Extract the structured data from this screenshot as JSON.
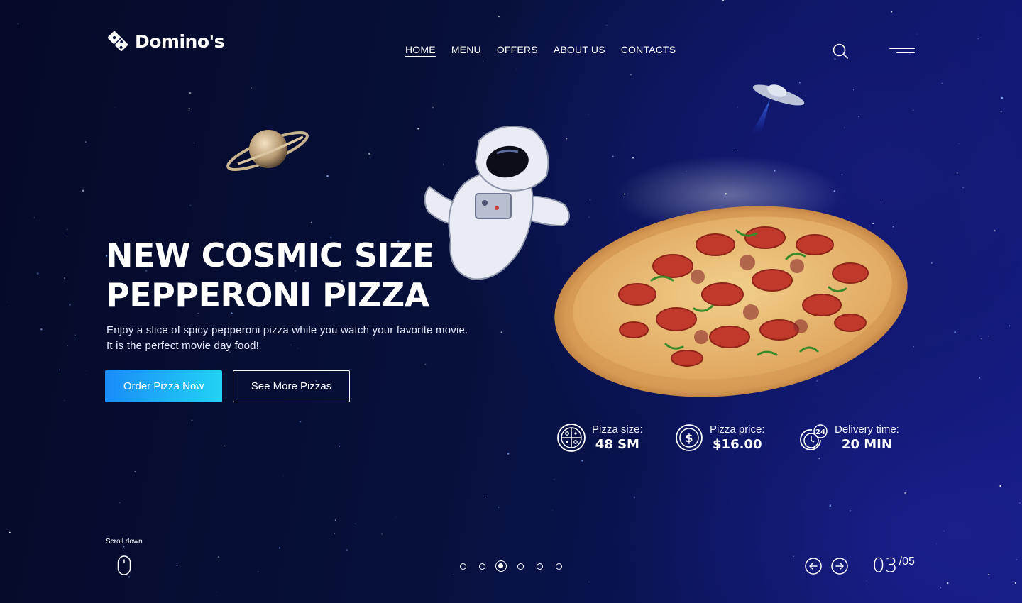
{
  "brand": {
    "name": "Domino's",
    "logo_icon": "domino-tile-icon"
  },
  "nav": {
    "items": [
      {
        "label": "HOME",
        "active": true
      },
      {
        "label": "MENU",
        "active": false
      },
      {
        "label": "OFFERS",
        "active": false
      },
      {
        "label": "ABOUT US",
        "active": false
      },
      {
        "label": "CONTACTS",
        "active": false
      }
    ],
    "search_icon": "search-icon",
    "menu_icon": "hamburger-menu-icon"
  },
  "hero": {
    "title": "NEW COSMIC SIZE\nPEPPERONI PIZZA",
    "description": "Enjoy a slice of spicy pepperoni pizza while you watch your favorite movie.\nIt is the perfect movie day food!",
    "primary_button": "Order Pizza Now",
    "secondary_button": "See More Pizzas"
  },
  "stats": [
    {
      "icon": "pizza-icon",
      "label": "Pizza size:",
      "value": "48 SM"
    },
    {
      "icon": "dollar-coin-icon",
      "label": "Pizza price:",
      "value": "$16.00"
    },
    {
      "icon": "clock-24-icon",
      "label": "Delivery time:",
      "value": "20 MIN"
    }
  ],
  "footer": {
    "scroll_label": "Scroll down",
    "scroll_icon": "mouse-icon",
    "slide_count": 6,
    "active_slide": 3,
    "pager_current": "03",
    "pager_total": "/05",
    "prev_icon": "arrow-left-circle-icon",
    "next_icon": "arrow-right-circle-icon"
  },
  "colors": {
    "background_dark": "#050a28",
    "background_blue": "#121a86",
    "accent_gradient_start": "#1a8cf7",
    "accent_gradient_end": "#22d3f5",
    "text": "#ffffff"
  }
}
